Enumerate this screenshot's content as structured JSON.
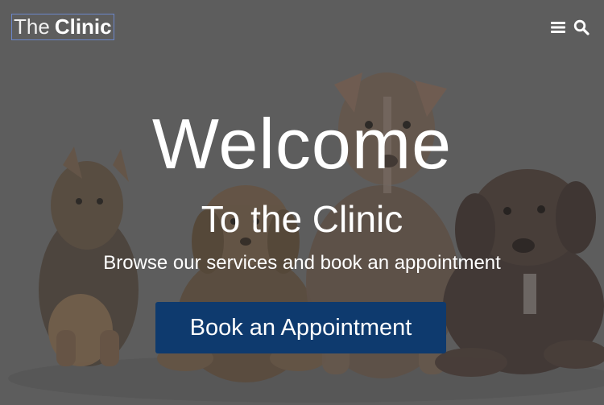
{
  "header": {
    "logo_light": "The",
    "logo_bold": "Clinic",
    "icons": [
      "menu-icon",
      "search-icon"
    ]
  },
  "hero": {
    "title": "Welcome",
    "subtitle": "To the Clinic",
    "tagline": "Browse our services and book an appointment",
    "cta_label": "Book an Appointment"
  },
  "colors": {
    "overlay": "#5f5f5f",
    "cta_background": "#0e3a6e",
    "text": "#ffffff",
    "logo_border": "#6b86c9"
  }
}
